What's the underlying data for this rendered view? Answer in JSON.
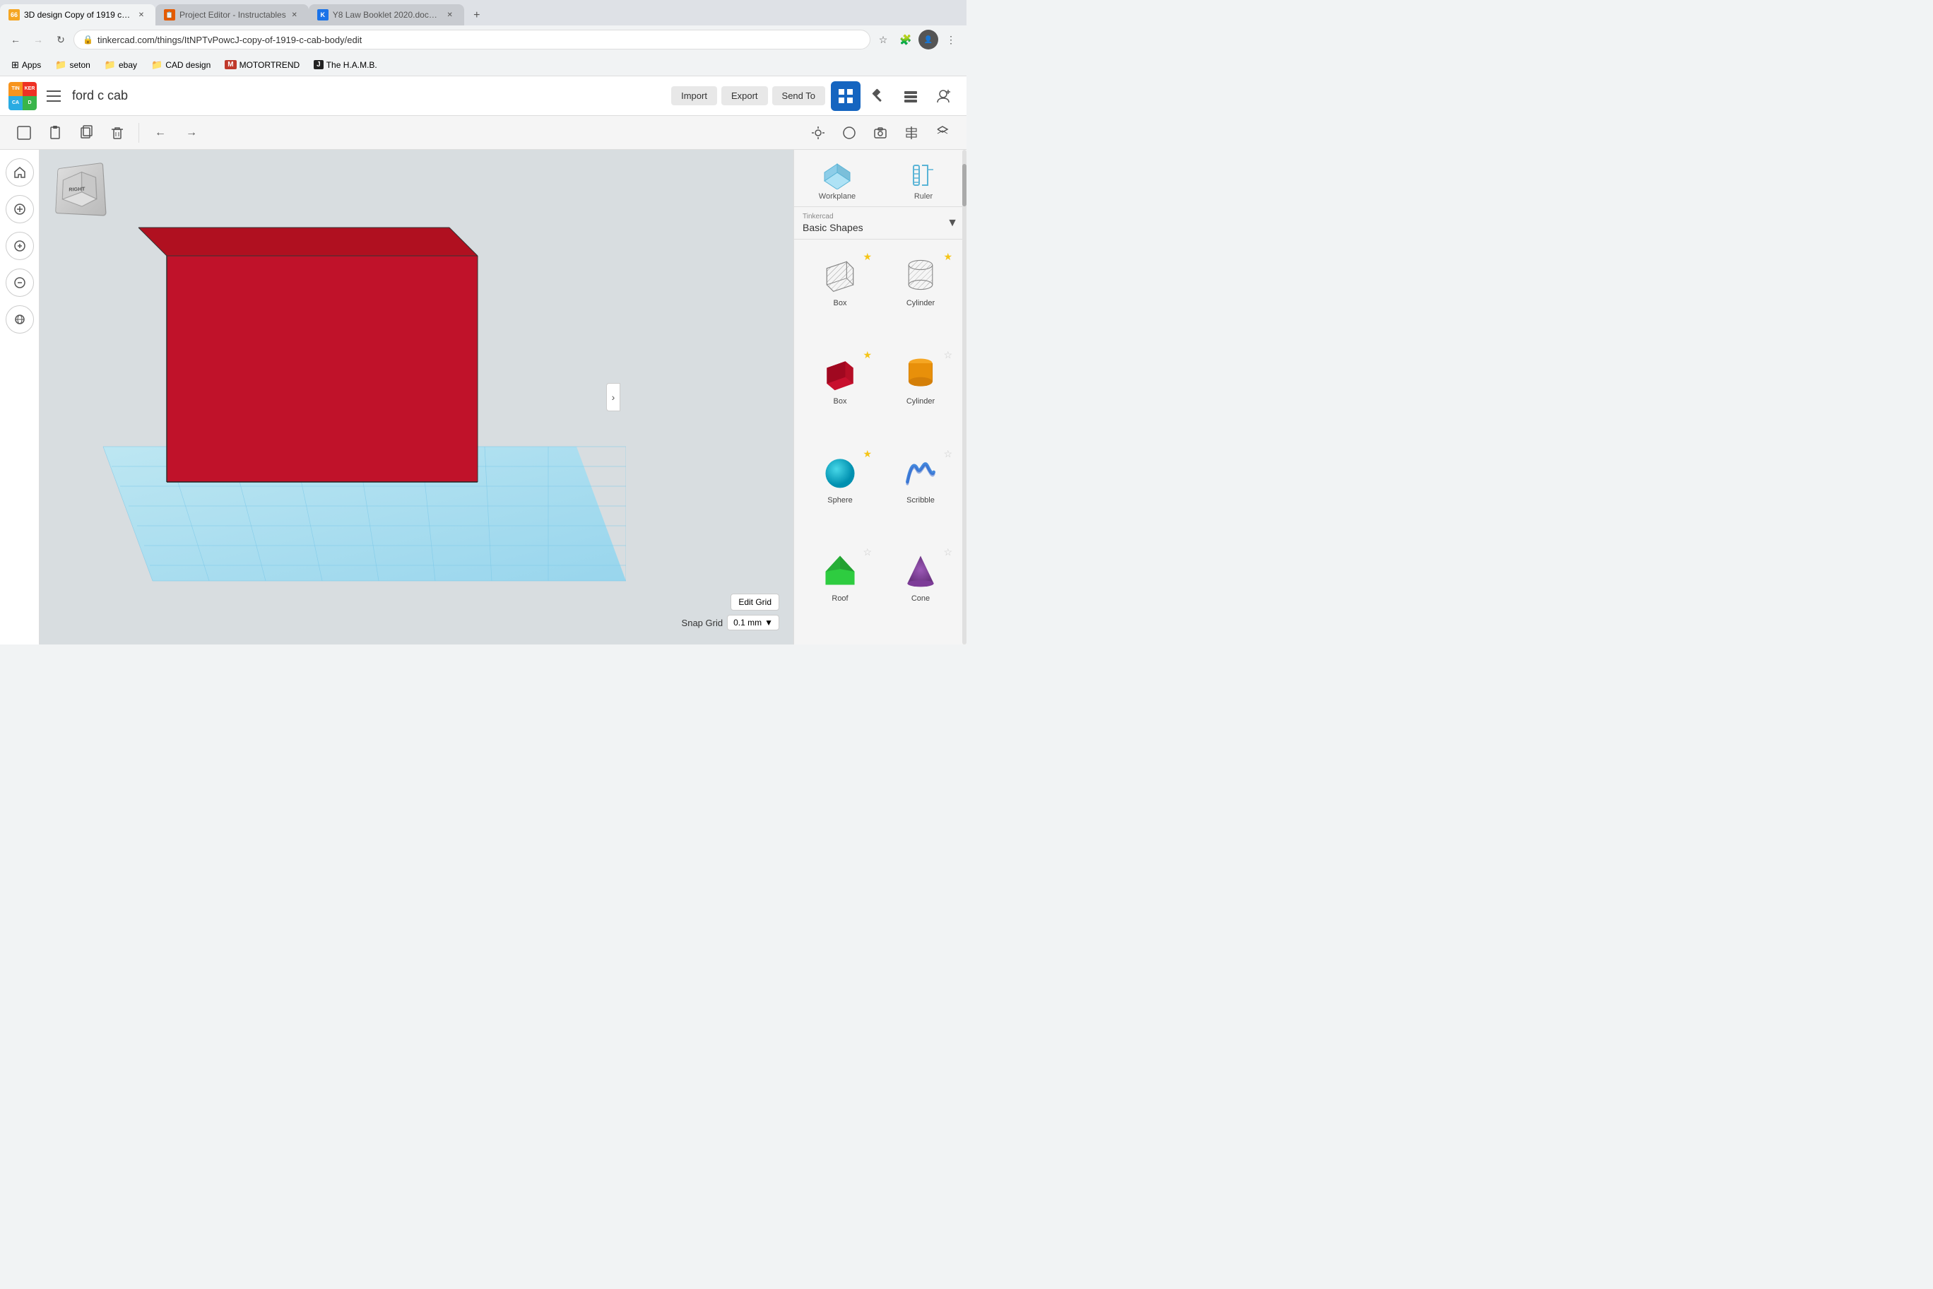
{
  "browser": {
    "tabs": [
      {
        "id": "tab1",
        "favicon_color": "#f5a623",
        "favicon_label": "66",
        "title": "3D design Copy of 1919 c-cab b...",
        "active": true
      },
      {
        "id": "tab2",
        "favicon_color": "#e55a00",
        "favicon_label": "📋",
        "title": "Project Editor - Instructables",
        "active": false
      },
      {
        "id": "tab3",
        "favicon_color": "#1a73e8",
        "favicon_label": "K",
        "title": "Y8 Law Booklet 2020.docx.pdf",
        "active": false
      }
    ],
    "address": "tinkercad.com/things/ItNPTvPowcJ-copy-of-1919-c-cab-body/edit",
    "bookmarks": [
      {
        "label": "Apps",
        "icon_color": "transparent",
        "icon_text": "⬛"
      },
      {
        "label": "seton",
        "icon_color": "#f5c518",
        "icon_text": "📁"
      },
      {
        "label": "ebay",
        "icon_color": "#f5c518",
        "icon_text": "📁"
      },
      {
        "label": "CAD design",
        "icon_color": "#f5c518",
        "icon_text": "📁"
      },
      {
        "label": "MOTORTREND",
        "icon_color": "#c0392b",
        "icon_text": "M"
      },
      {
        "label": "The H.A.M.B.",
        "icon_color": "#000",
        "icon_text": "J"
      }
    ]
  },
  "tinkercad": {
    "project_name": "ford c cab",
    "toolbar": {
      "import_label": "Import",
      "export_label": "Export",
      "send_to_label": "Send To"
    },
    "edit_toolbar": {
      "undo_label": "↩",
      "redo_label": "↪"
    },
    "right_panel": {
      "workplane_label": "Workplane",
      "ruler_label": "Ruler",
      "category_label": "Tinkercad",
      "shapes_title": "Basic Shapes",
      "shapes": [
        {
          "name": "Box",
          "starred": true,
          "type": "box-grey"
        },
        {
          "name": "Cylinder",
          "starred": true,
          "type": "cylinder-grey"
        },
        {
          "name": "Box",
          "starred": true,
          "type": "box-red"
        },
        {
          "name": "Cylinder",
          "starred": false,
          "type": "cylinder-orange"
        },
        {
          "name": "Sphere",
          "starred": true,
          "type": "sphere-teal"
        },
        {
          "name": "Scribble",
          "starred": false,
          "type": "scribble-blue"
        },
        {
          "name": "Roof",
          "starred": false,
          "type": "roof-green"
        },
        {
          "name": "Cone",
          "starred": false,
          "type": "cone-purple"
        }
      ]
    },
    "viewport": {
      "edit_grid_label": "Edit Grid",
      "snap_grid_label": "Snap Grid",
      "snap_value": "0.1 mm"
    }
  }
}
